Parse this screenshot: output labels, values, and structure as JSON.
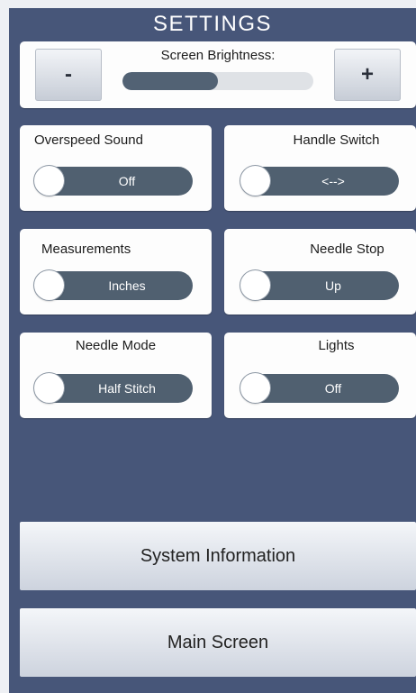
{
  "header": {
    "title": "SETTINGS"
  },
  "brightness": {
    "label": "Screen Brightness:",
    "minus_label": "-",
    "plus_label": "+",
    "level_percent": 50
  },
  "options": [
    {
      "label": "Overspeed Sound",
      "value": "Off"
    },
    {
      "label": "Handle Switch",
      "value": "<-->"
    },
    {
      "label": "Measurements",
      "value": "Inches"
    },
    {
      "label": "Needle Stop",
      "value": "Up"
    },
    {
      "label": "Needle Mode",
      "value": "Half Stitch"
    },
    {
      "label": "Lights",
      "value": "Off"
    }
  ],
  "buttons": {
    "system_info": "System Information",
    "main_screen": "Main Screen"
  },
  "colors": {
    "background": "#475679",
    "toggle": "#506070",
    "panel": "#fdfdfd"
  }
}
